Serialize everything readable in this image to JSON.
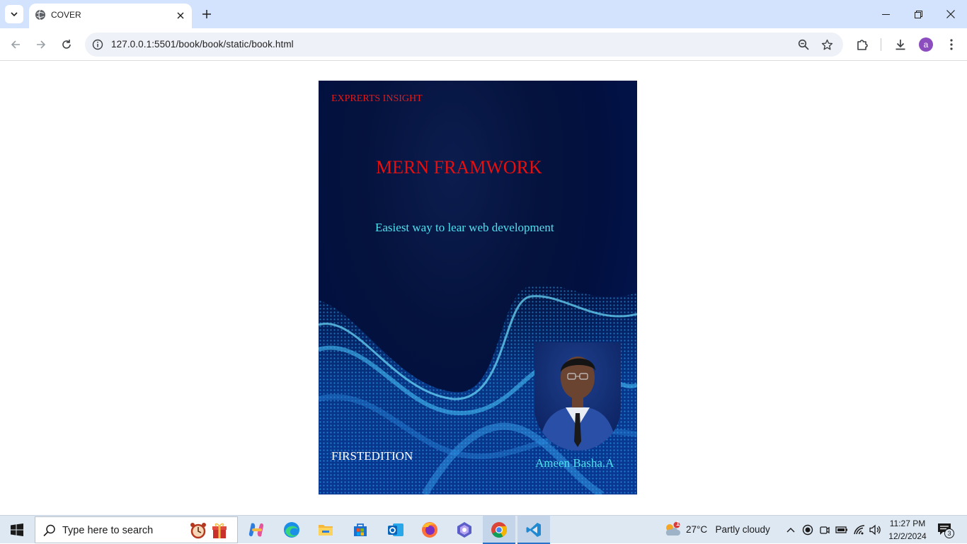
{
  "browser": {
    "tab": {
      "title": "COVER"
    },
    "url": "127.0.0.1:5501/book/book/static/book.html",
    "profile_initial": "a"
  },
  "cover": {
    "series": "EXPRERTS INSIGHT",
    "title": "MERN FRAMWORK",
    "subtitle": "Easiest way to lear web development",
    "edition": "FIRSTEDITION",
    "author": "Ameen Basha.A",
    "colors": {
      "title": "#e60f0f",
      "accent": "#4fe1f0",
      "background": "#021041"
    }
  },
  "taskbar": {
    "search_placeholder": "Type here to search",
    "weather": {
      "temp": "27°C",
      "condition": "Partly cloudy",
      "badge": "1"
    },
    "time": "11:27 PM",
    "date": "12/2/2024",
    "notification_count": "3",
    "apps": [
      "copilot-icon",
      "edge-icon",
      "file-explorer-icon",
      "store-icon",
      "outlook-icon",
      "firefox-icon",
      "slack-icon",
      "chrome-icon",
      "vscode-icon"
    ]
  }
}
